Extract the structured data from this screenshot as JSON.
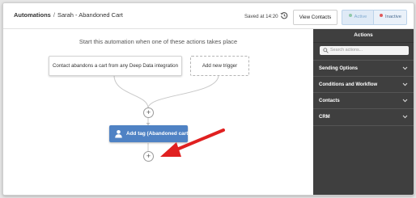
{
  "header": {
    "breadcrumb_root": "Automations",
    "breadcrumb_separator": "/",
    "breadcrumb_current": "Sarah - Abandoned Cart",
    "saved_text": "Saved at 14:20",
    "view_contacts_label": "View Contacts",
    "toggle_active_label": "Active",
    "toggle_inactive_label": "Inactive",
    "toggle_selected": "Inactive"
  },
  "canvas": {
    "start_text": "Start this automation when one of these actions takes place",
    "trigger_label": "Contact abandons a cart from any Deep Data integration",
    "add_trigger_label": "Add new trigger",
    "plus_symbol": "+",
    "action_node_label": "Add tag (Abandoned cart)"
  },
  "panel": {
    "title": "Actions",
    "search_placeholder": "Search actions...",
    "sections": [
      {
        "label": "Sending Options"
      },
      {
        "label": "Conditions and Workflow"
      },
      {
        "label": "Contacts"
      },
      {
        "label": "CRM"
      }
    ]
  },
  "colors": {
    "node_blue": "#4f82c4",
    "panel_bg": "#3f3f3f",
    "annotation_arrow": "#e02020",
    "active_dot": "#8fc8a8",
    "inactive_dot": "#e05a5a"
  }
}
